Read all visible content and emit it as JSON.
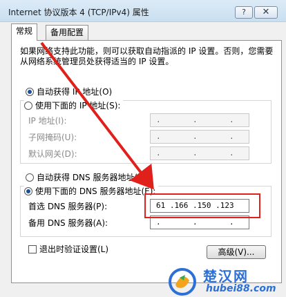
{
  "window": {
    "title": "Internet 协议版本 4 (TCP/IPv4) 属性",
    "help_label": "?",
    "close_label": "✕"
  },
  "tabs": [
    {
      "label": "常规",
      "active": true
    },
    {
      "label": "备用配置",
      "active": false
    }
  ],
  "description": "如果网络支持此功能，则可以获取自动指派的 IP 设置。否则，您需要从网络系统管理员处获得适当的 IP 设置。",
  "ip": {
    "auto_label": "自动获得 IP 地址(O)",
    "manual_label": "使用下面的 IP 地址(S):",
    "auto_selected": true,
    "fields": [
      {
        "label": "IP 地址(I):",
        "value": ".       .       ."
      },
      {
        "label": "子网掩码(U):",
        "value": ".       .       ."
      },
      {
        "label": "默认网关(D):",
        "value": ".       .       ."
      }
    ]
  },
  "dns": {
    "auto_label": "自动获得 DNS 服务器地址(B)",
    "manual_label": "使用下面的 DNS 服务器地址(E):",
    "manual_selected": true,
    "preferred_label": "首选 DNS 服务器(P):",
    "preferred_value": "61 .166 .150 .123",
    "alternate_label": "备用 DNS 服务器(A):",
    "alternate_value": ".       .       ."
  },
  "validate_label": "退出时验证设置(L)",
  "advanced_label": "高级(V)...",
  "watermark": {
    "title": "楚汉网",
    "url": "hubei88.com"
  },
  "colors": {
    "highlight": "#e0201a",
    "radio_dot": "#1b4f9c",
    "watermark": "#2c6fd6"
  }
}
